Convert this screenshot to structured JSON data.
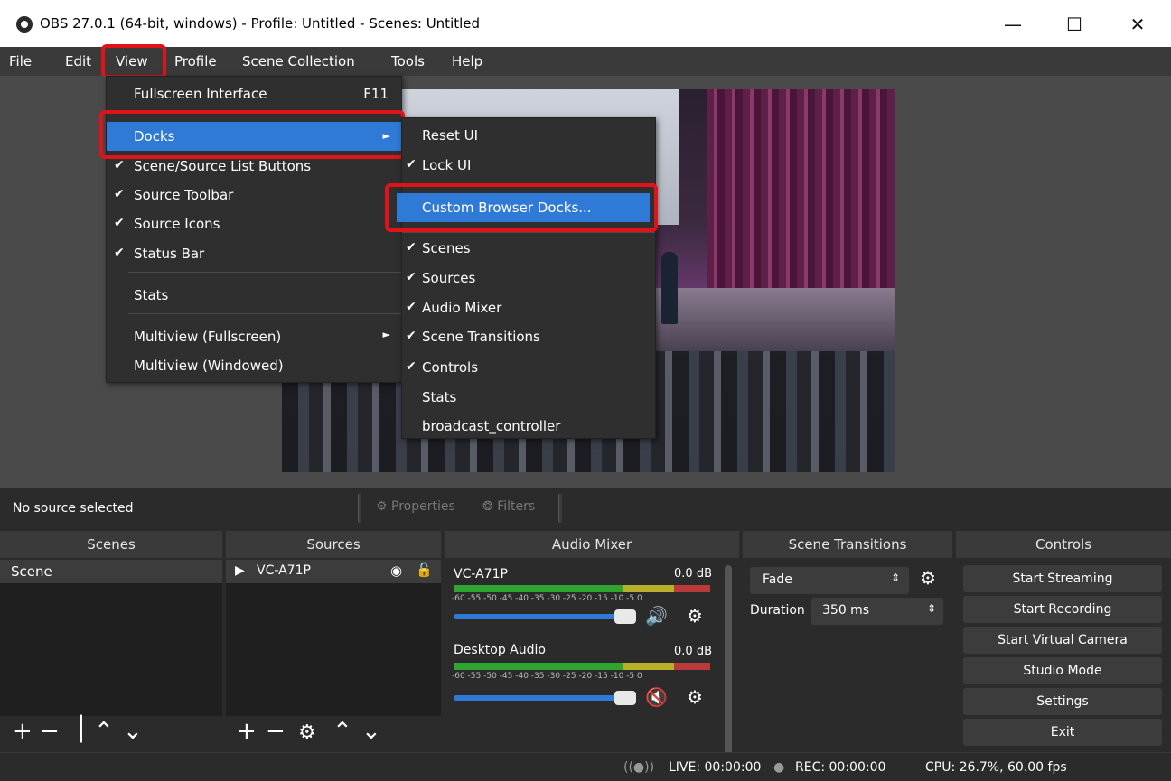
{
  "window": {
    "title": "OBS 27.0.1 (64-bit, windows) - Profile: Untitled - Scenes: Untitled",
    "minimize": "—",
    "maximize": "☐",
    "close": "✕"
  },
  "menubar": {
    "items": [
      "File",
      "Edit",
      "View",
      "Profile",
      "Scene Collection",
      "Tools",
      "Help"
    ]
  },
  "view_menu": {
    "items": [
      {
        "label": "Fullscreen Interface",
        "shortcut": "F11"
      },
      {
        "label": "Docks",
        "submenu": "►"
      },
      {
        "label": "Scene/Source List Buttons",
        "check": "✔"
      },
      {
        "label": "Source Toolbar",
        "check": "✔"
      },
      {
        "label": "Source Icons",
        "check": "✔"
      },
      {
        "label": "Status Bar",
        "check": "✔"
      },
      {
        "label": "Stats"
      },
      {
        "label": "Multiview (Fullscreen)",
        "submenu": "►"
      },
      {
        "label": "Multiview (Windowed)"
      }
    ]
  },
  "docks_menu": {
    "items": [
      {
        "label": "Reset UI"
      },
      {
        "label": "Lock UI",
        "check": "✔"
      },
      {
        "label": "Custom Browser Docks..."
      },
      {
        "label": "Scenes",
        "check": "✔"
      },
      {
        "label": "Sources",
        "check": "✔"
      },
      {
        "label": "Audio Mixer",
        "check": "✔"
      },
      {
        "label": "Scene Transitions",
        "check": "✔"
      },
      {
        "label": "Controls",
        "check": "✔"
      },
      {
        "label": "Stats"
      },
      {
        "label": "broadcast_controller"
      }
    ]
  },
  "source_toolbar": {
    "status": "No source selected",
    "properties": "Properties",
    "filters": "Filters"
  },
  "docks": {
    "scenes": {
      "title": "Scenes",
      "items": [
        "Scene"
      ]
    },
    "sources": {
      "title": "Sources",
      "items": [
        "VC-A71P"
      ]
    },
    "audio_mixer": {
      "title": "Audio Mixer",
      "ticks": "-60 -55 -50 -45 -40 -35 -30 -25 -20 -15 -10  -5   0",
      "channels": [
        {
          "name": "VC-A71P",
          "db": "0.0 dB",
          "volume_fraction": 1.0,
          "muted": false
        },
        {
          "name": "Desktop Audio",
          "db": "0.0 dB",
          "volume_fraction": 1.0,
          "muted": true
        }
      ]
    },
    "transitions": {
      "title": "Scene Transitions",
      "selected": "Fade",
      "duration_label": "Duration",
      "duration_value": "350 ms"
    },
    "controls": {
      "title": "Controls",
      "buttons": [
        "Start Streaming",
        "Start Recording",
        "Start Virtual Camera",
        "Studio Mode",
        "Settings",
        "Exit"
      ]
    }
  },
  "statusbar": {
    "live": "LIVE: 00:00:00",
    "rec": "REC: 00:00:00",
    "cpu": "CPU: 26.7%, 60.00 fps"
  },
  "colors": {
    "accent": "#2f7ad6",
    "highlight_box": "#e0131b",
    "panel_bg": "#2b2b2b"
  }
}
